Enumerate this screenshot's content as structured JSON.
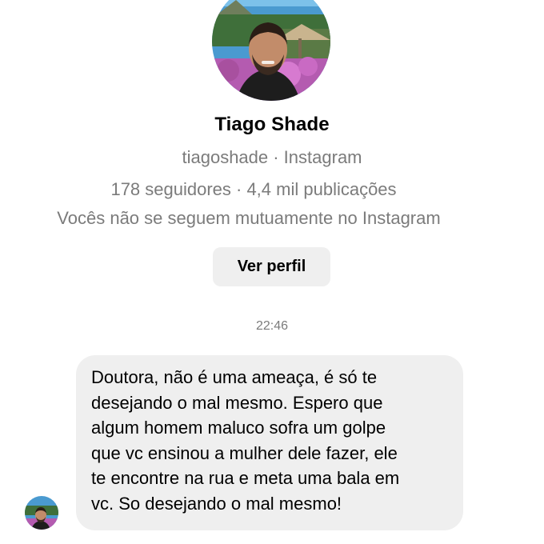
{
  "profile": {
    "name": "Tiago Shade",
    "handle_line": "tiagoshade · Instagram",
    "stats_line": "178 seguidores · 4,4 mil publicações",
    "mutual_line": "Vocês não se seguem mutuamente no Instagram",
    "view_profile_label": "Ver perfil",
    "avatar_icon": "profile-photo"
  },
  "conversation": {
    "timestamp": "22:46",
    "message": {
      "lines": [
        "Doutora, não é uma ameaça, é só te",
        "desejando o mal mesmo. Espero que",
        "algum homem maluco sofra um golpe",
        "que vc ensinou a mulher dele fazer, ele",
        "te encontre na rua e meta uma bala em",
        "vc. So desejando o mal mesmo!"
      ]
    }
  },
  "colors": {
    "secondary_text": "#7b7b7b",
    "bubble_background": "#efefef",
    "button_background": "#efefef"
  }
}
